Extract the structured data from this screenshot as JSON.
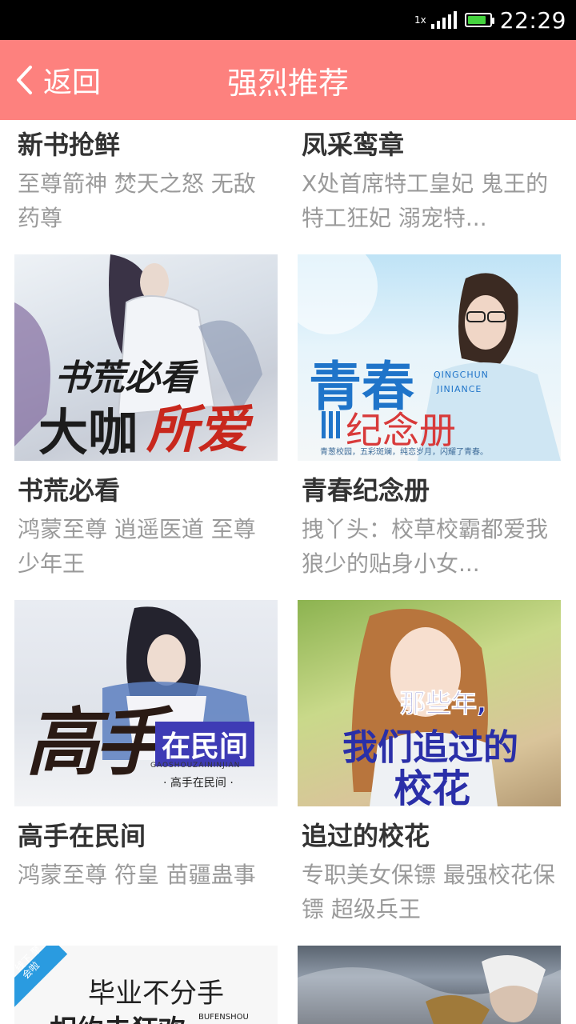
{
  "status": {
    "time": "22:29",
    "signal_tag": "1x"
  },
  "header": {
    "back_label": "返回",
    "title": "强烈推荐"
  },
  "books": [
    {
      "title": "新书抢鲜",
      "desc": "至尊箭神 焚天之怒 无敌药尊"
    },
    {
      "title": "凤采鸾章",
      "desc": "X处首席特工皇妃 鬼王的特工狂妃 溺宠特..."
    },
    {
      "title": "书荒必看",
      "desc": "鸿蒙至尊 逍遥医道 至尊少年王",
      "cover": {
        "line1": "书荒必看",
        "line2a": "大咖",
        "line2b": "所爱"
      }
    },
    {
      "title": "青春纪念册",
      "desc": "拽丫头：校草校霸都爱我 狼少的贴身小女...",
      "cover": {
        "big": "青春",
        "pinyin1": "QINGCHUN",
        "pinyin2": "JINIANCE",
        "sub": "纪念册",
        "tagline": "青葱校园，五彩斑斓，纯恋岁月，闪耀了青春。"
      }
    },
    {
      "title": "高手在民间",
      "desc": "鸿蒙至尊 符皇 苗疆蛊事",
      "cover": {
        "big": "高手",
        "badge": "在民间",
        "pinyin": "GAOSHOUZAININJIAN",
        "sub": "· 高手在民间 ·"
      }
    },
    {
      "title": "追过的校花",
      "desc": "专职美女保镖 最强校花保镖 超级兵王",
      "cover": {
        "line1": "那些年,",
        "line2": "我们追过的",
        "line3": "校花"
      }
    },
    {
      "title": "",
      "desc": "",
      "cover": {
        "ribbon": "线下 聚会啦",
        "line1": "毕业不分手",
        "line2": "相约去狂欢",
        "pinyin": "BUFENSHOU"
      }
    },
    {
      "title": "",
      "desc": ""
    }
  ]
}
